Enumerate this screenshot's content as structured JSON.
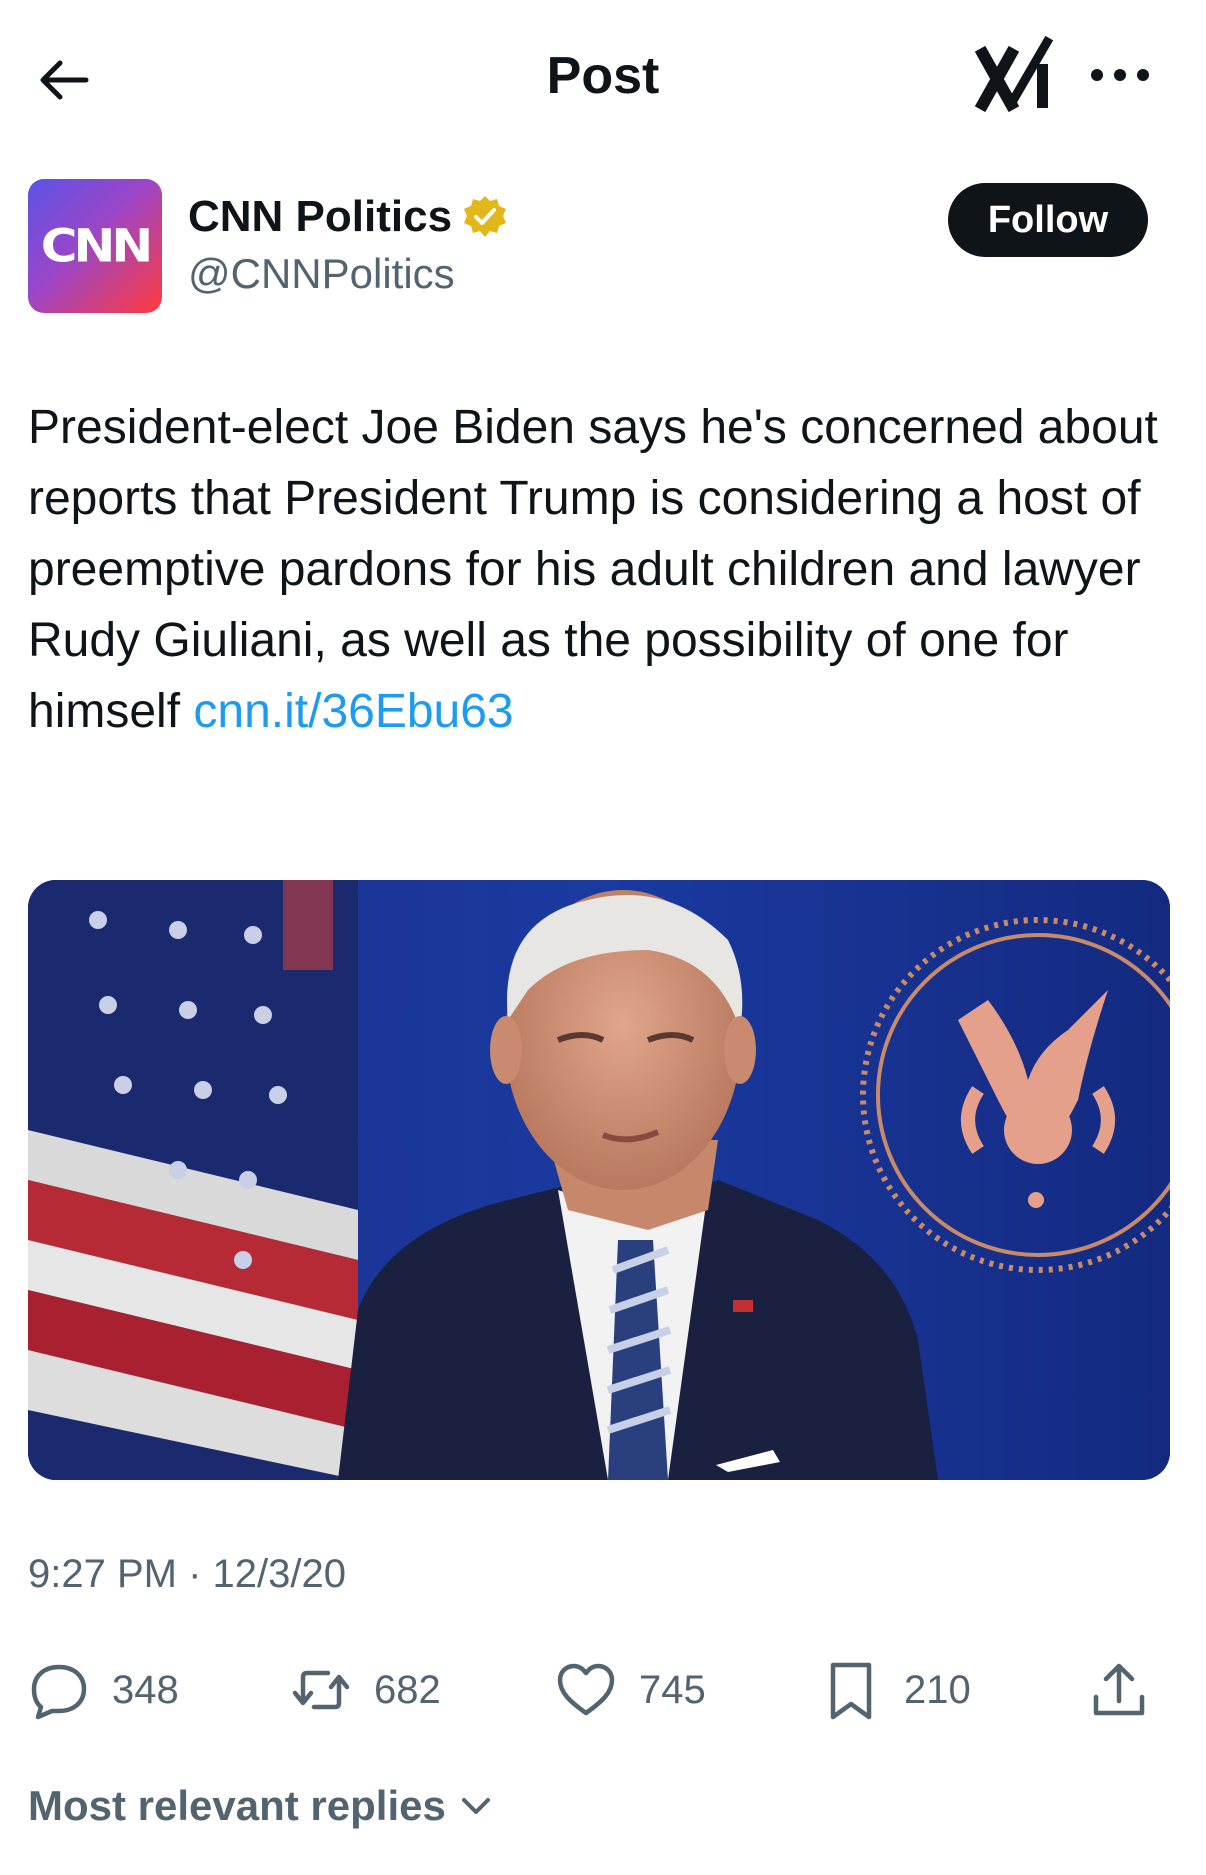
{
  "header": {
    "title": "Post",
    "back_icon": "arrow-left-icon",
    "grok_icon": "grok-icon",
    "more_icon": "more-horizontal-icon"
  },
  "author": {
    "name": "CNN Politics",
    "handle": "@CNNPolitics",
    "avatar_text": "CNN",
    "verified": true,
    "follow_label": "Follow"
  },
  "tweet": {
    "text": "President-elect Joe Biden says he's concerned about reports that President Trump is considering a host of preemptive pardons for his adult children and lawyer Rudy Giuliani, as well as the possibility of one for himself ",
    "link": "cnn.it/​36Ebu63",
    "timestamp": "9:27 PM · 12/3/20"
  },
  "actions": {
    "replies": "348",
    "reposts": "682",
    "likes": "745",
    "bookmarks": "210"
  },
  "replies_section": {
    "label": "Most relevant replies"
  },
  "colors": {
    "link": "#1d9bf0",
    "secondary_text": "#536471",
    "primary_text": "#0f1419",
    "verified_badge": "#e2b719"
  }
}
